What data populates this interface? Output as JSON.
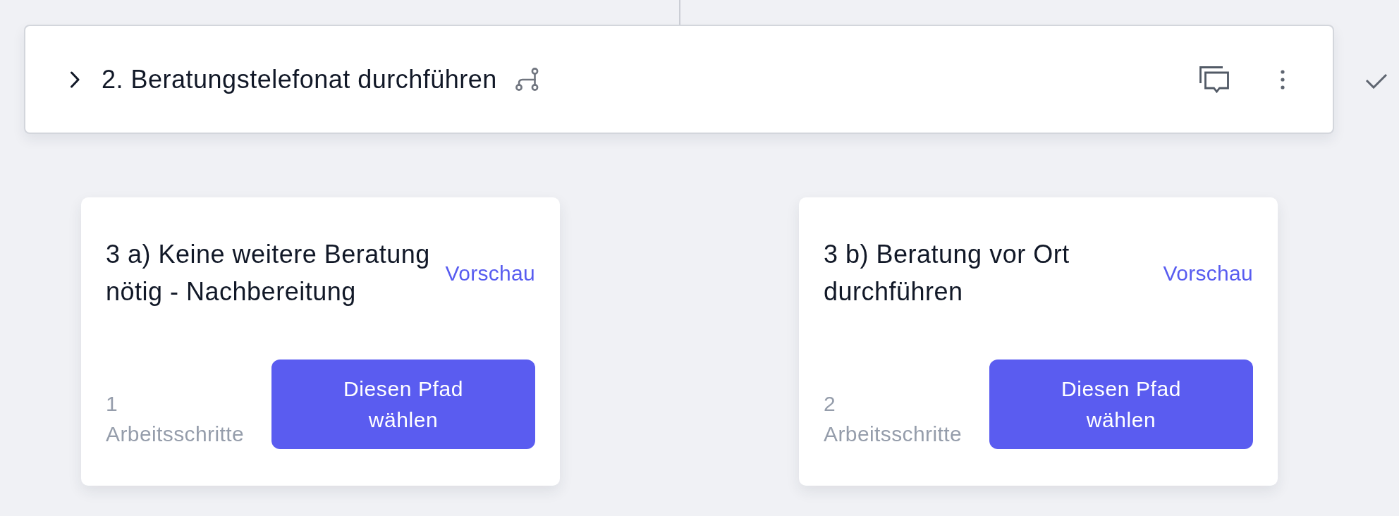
{
  "step": {
    "title": "2. Beratungstelefonat durchführen",
    "expanded": false
  },
  "paths": [
    {
      "title": "3 a) Keine weitere Beratung nötig - Nachbereitung",
      "preview": "Vorschau",
      "steps_label": "1 Arbeitsschritte",
      "button": "Diesen Pfad wählen"
    },
    {
      "title": "3 b) Beratung vor Ort durchführen",
      "preview": "Vorschau",
      "steps_label": "2 Arbeitsschritte",
      "button": "Diesen Pfad wählen"
    }
  ]
}
